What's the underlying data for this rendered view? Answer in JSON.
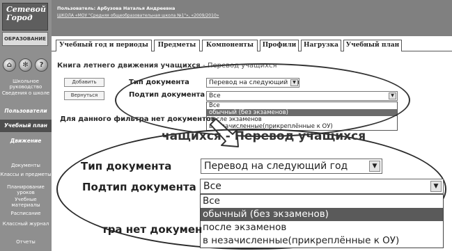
{
  "app": {
    "logo": "Сетевой Город",
    "logo_sub": "ОБРАЗОВАНИЕ"
  },
  "header": {
    "user": "Пользователь: Арбузова Наталья Андреевна",
    "school": "ШКОЛА «МОУ \"Средняя общеобразовательная школа №1\"», «2009/2010»"
  },
  "sidebar": {
    "icons": [
      "home-icon",
      "gear-icon",
      "help-icon"
    ],
    "icon_glyphs": [
      "⌂",
      "✻",
      "?"
    ],
    "items": [
      "Школьное руководство",
      "Сведения о школе",
      "Пользователи",
      "Учебный план",
      "Движение",
      "Документы",
      "Классы и предметы",
      "Планирование уроков",
      "Учебные материалы",
      "Расписание",
      "Классный журнал",
      "Отчеты"
    ]
  },
  "tabs": [
    "Учебный год и периоды",
    "Предметы",
    "Компоненты",
    "Профили",
    "Нагрузка",
    "Учебный план"
  ],
  "main": {
    "title": "Книга летнего движения учащихся",
    "title_suffix": "- Перевод учащихся",
    "add_button": "Добавить",
    "back_button": "Вернуться",
    "doc_type_label": "Тип документа",
    "doc_type_value": "Перевод на следующий год",
    "doc_subtype_label": "Подтип документа",
    "doc_subtype_value": "Все",
    "subtype_options": [
      "Все",
      "обычный (без экзаменов)",
      "после экзаменов",
      "в незачисленные(прикреплённые к ОУ)"
    ],
    "selected_option": 1,
    "no_data_text": "Для данного фильтра нет документов"
  },
  "zoom": {
    "title": "чащихся - Перевод учащихся",
    "doc_type_label": "Тип документа",
    "doc_type_value": "Перевод на следующий год",
    "doc_subtype_label": "Подтип документа",
    "doc_subtype_value": "Все",
    "options": [
      "Все",
      "обычный (без экзаменов)",
      "после экзаменов",
      "в незачисленные(прикреплённые к ОУ)"
    ],
    "no_data_text": "тра нет докумен"
  }
}
